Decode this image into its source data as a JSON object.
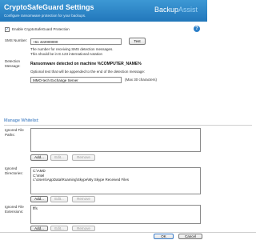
{
  "header": {
    "title": "CryptoSafeGuard Settings",
    "subtitle": "Configure ransomware protection for your backups.",
    "brand_main": "Backup",
    "brand_accent": "Assist"
  },
  "enable": {
    "label": "Enable CryptoSafeGuard Protection",
    "checked": true,
    "check_glyph": "✓"
  },
  "help_glyph": "?",
  "sms": {
    "label": "SMS Number:",
    "value": "+61 422000000",
    "test_label": "Test",
    "hint_line1": "The number for receiving SMS detection messages.",
    "hint_line2": "This should be in E.123 international notation"
  },
  "detection": {
    "label_line1": "Detection",
    "label_line2": "Message:",
    "message": "Ransomware detected on machine %COMPUTER_NAME%",
    "optional_hint": "Optional text that will be appended to the end of the detection message:",
    "append_value": "MMO-tech Exchange Server",
    "max_chars": "(Max 30 characters)"
  },
  "whitelist": {
    "title": "Manage Whitelist:",
    "paths": {
      "label_line1": "Ignored File",
      "label_line2": "Paths:",
      "items": []
    },
    "directories": {
      "label_line1": "Ignored",
      "label_line2": "Directories:",
      "items": [
        "C:\\AMD",
        "C:\\Intel",
        "c:\\Users\\AppData\\Roaming\\Skype\\My Skype Received Files"
      ]
    },
    "extensions": {
      "label_line1": "Ignored File",
      "label_line2": "Extensions:",
      "items": [
        "fffs"
      ]
    },
    "add_label": "Add...",
    "edit_label": "Edit...",
    "remove_label": "Remove"
  },
  "footer": {
    "ok_label": "OK",
    "cancel_label": "Cancel"
  },
  "colors": {
    "header_blue": "#2a82c6",
    "accent_blue": "#2a6ebb"
  }
}
